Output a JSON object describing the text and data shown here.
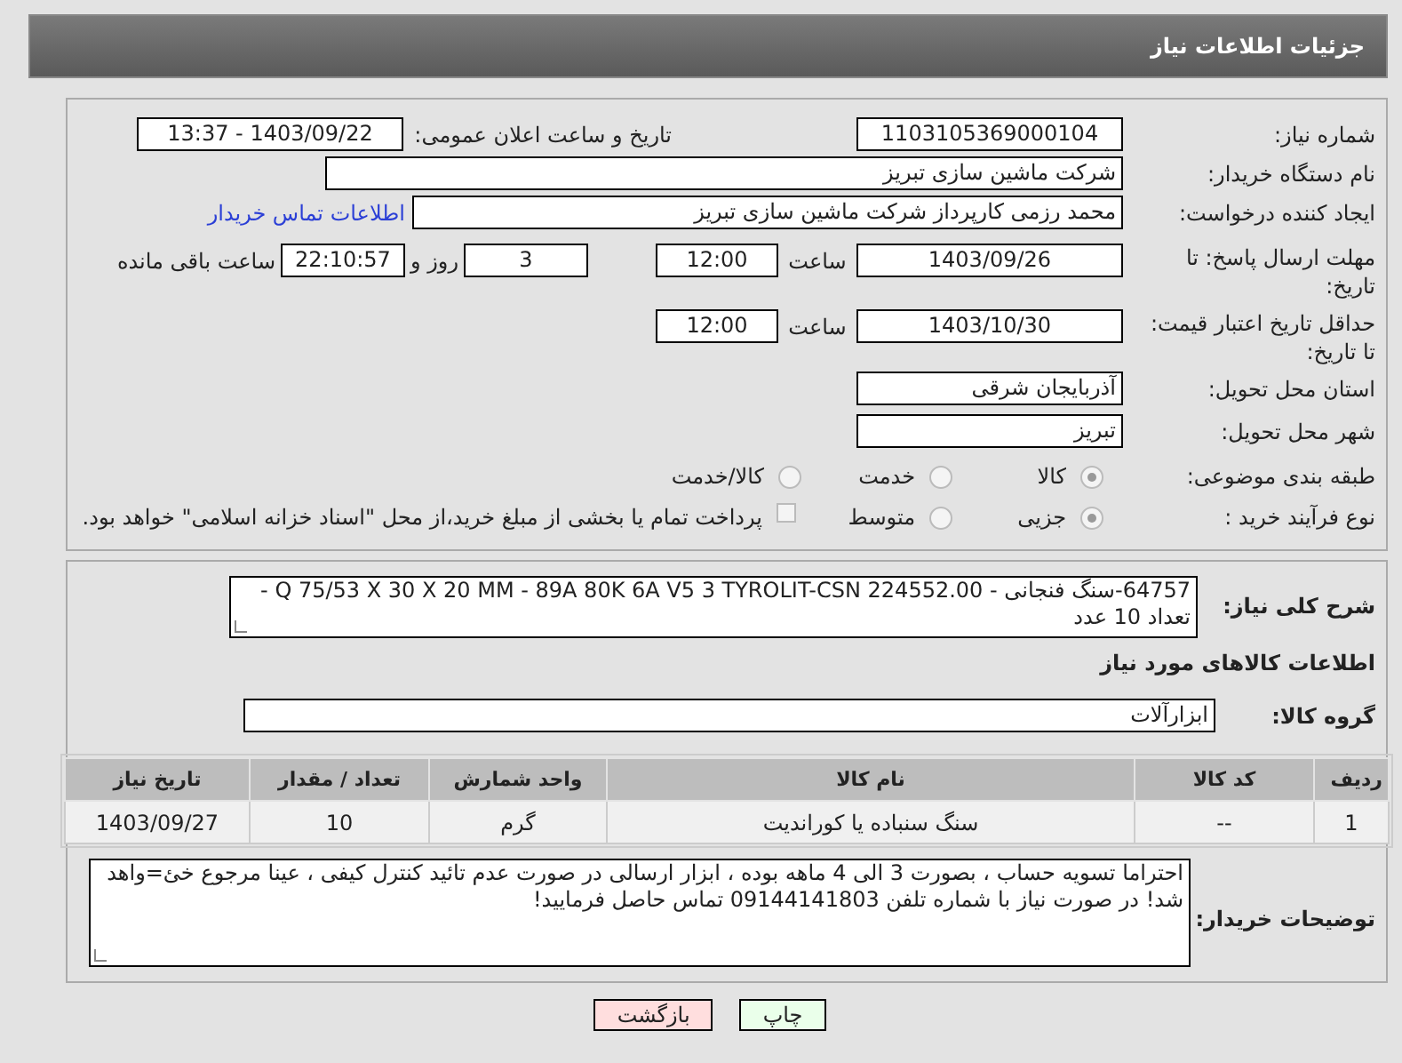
{
  "header": {
    "title": "جزئیات اطلاعات نیاز"
  },
  "details": {
    "need_number": {
      "label": "شماره نیاز:",
      "value": "1103105369000104"
    },
    "announce": {
      "label": "تاریخ و ساعت اعلان عمومی:",
      "value": "1403/09/22 - 13:37"
    },
    "buyer_org": {
      "label": "نام دستگاه خریدار:",
      "value": "شرکت ماشین سازی تبریز"
    },
    "requester": {
      "label": "ایجاد کننده درخواست:",
      "value": "محمد رزمی کارپرداز شرکت ماشین سازی تبریز",
      "link": "اطلاعات تماس خریدار"
    },
    "response_deadline": {
      "label": "مهلت ارسال پاسخ: تا تاریخ:",
      "date": "1403/09/26",
      "time_label": "ساعت",
      "time": "12:00",
      "days": "3",
      "days_label": "روز و",
      "remaining": "22:10:57",
      "remaining_label": "ساعت باقی مانده"
    },
    "price_validity": {
      "label": "حداقل تاریخ اعتبار قیمت: تا تاریخ:",
      "date": "1403/10/30",
      "time_label": "ساعت",
      "time": "12:00"
    },
    "province": {
      "label": "استان محل تحویل:",
      "value": "آذربایجان شرقی"
    },
    "city": {
      "label": "شهر محل تحویل:",
      "value": "تبریز"
    },
    "category": {
      "label": "طبقه بندی موضوعی:",
      "options": [
        {
          "label": "کالا",
          "selected": true
        },
        {
          "label": "خدمت",
          "selected": false
        },
        {
          "label": "کالا/خدمت",
          "selected": false
        }
      ]
    },
    "process": {
      "label": "نوع فرآیند خرید :",
      "options": [
        {
          "label": "جزیی",
          "selected": true
        },
        {
          "label": "متوسط",
          "selected": false
        }
      ],
      "treasury": {
        "label": "پرداخت تمام یا بخشی از مبلغ خرید،از محل \"اسناد خزانه اسلامی\" خواهد بود.",
        "checked": false
      }
    }
  },
  "needs": {
    "description": {
      "label": "شرح کلی نیاز:",
      "value": "64757-سنگ فنجانی - Q 75/53 X 30 X 20 MM - 89A 80K 6A V5 3  TYROLIT-CSN 224552.00 - تعداد 10 عدد"
    },
    "items_heading": "اطلاعات کالاهای مورد نیاز",
    "group": {
      "label": "گروه کالا:",
      "value": "ابزارآلات"
    },
    "table": {
      "columns": [
        "ردیف",
        "کد کالا",
        "نام کالا",
        "واحد شمارش",
        "تعداد / مقدار",
        "تاریخ نیاز"
      ],
      "rows": [
        [
          "1",
          "--",
          "سنگ سنباده یا کوراندیت",
          "گرم",
          "10",
          "1403/09/27"
        ]
      ]
    },
    "buyer_notes": {
      "label": "توضیحات خریدار:",
      "value": "احتراما تسویه حساب ، بصورت 3 الی 4 ماهه بوده ، ابزار ارسالی در صورت عدم تائید کنترل کیفی ، عینا مرجوع خئ=واهد شد! در صورت نیاز با شماره تلفن 09144141803 تماس حاصل فرمایید!"
    }
  },
  "buttons": [
    {
      "label": "چاپ",
      "kind": "print"
    },
    {
      "label": "بازگشت",
      "kind": "back"
    }
  ]
}
